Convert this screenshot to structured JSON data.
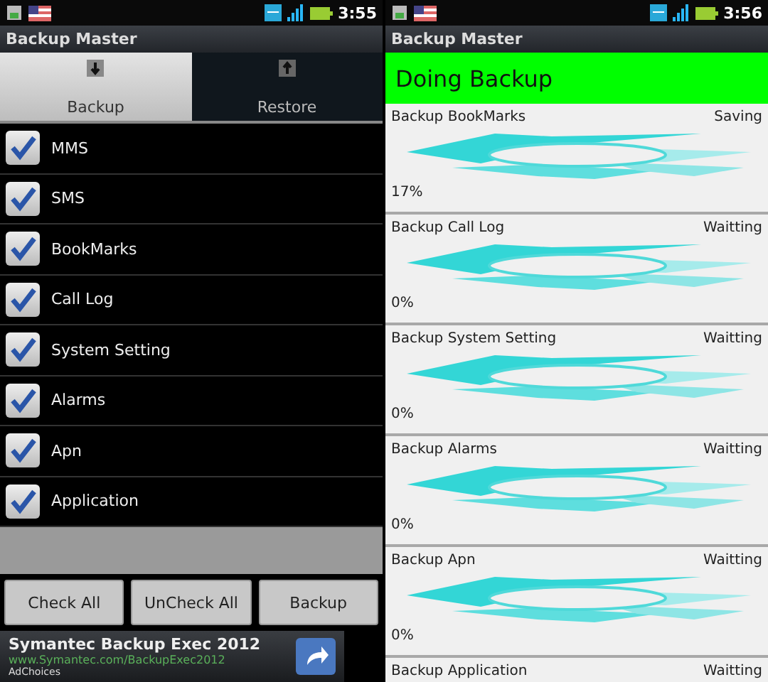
{
  "screens": [
    {
      "status_bar": {
        "time": "3:55"
      },
      "title": "Backup Master",
      "tabs": [
        {
          "label": "Backup",
          "selected": true
        },
        {
          "label": "Restore",
          "selected": false
        }
      ],
      "items": [
        {
          "label": "MMS",
          "checked": true
        },
        {
          "label": "SMS",
          "checked": true
        },
        {
          "label": "BookMarks",
          "checked": true
        },
        {
          "label": "Call Log",
          "checked": true
        },
        {
          "label": "System Setting",
          "checked": true
        },
        {
          "label": "Alarms",
          "checked": true
        },
        {
          "label": "Apn",
          "checked": true
        },
        {
          "label": "Application",
          "checked": true
        }
      ],
      "buttons": [
        "Check All",
        "UnCheck All",
        "Backup"
      ],
      "ad": {
        "title": "Symantec Backup Exec 2012",
        "url": "www.Symantec.com/BackupExec2012",
        "note": "AdChoices"
      }
    },
    {
      "status_bar": {
        "time": "3:56"
      },
      "title": "Backup Master",
      "header": "Doing Backup",
      "tasks": [
        {
          "name": "Backup BookMarks",
          "status": "Saving",
          "percent": "17%"
        },
        {
          "name": "Backup Call Log",
          "status": "Waitting",
          "percent": "0%"
        },
        {
          "name": "Backup System Setting",
          "status": "Waitting",
          "percent": "0%"
        },
        {
          "name": "Backup Alarms",
          "status": "Waitting",
          "percent": "0%"
        },
        {
          "name": "Backup Apn",
          "status": "Waitting",
          "percent": "0%"
        },
        {
          "name": "Backup Application",
          "status": "Waitting"
        }
      ]
    }
  ]
}
